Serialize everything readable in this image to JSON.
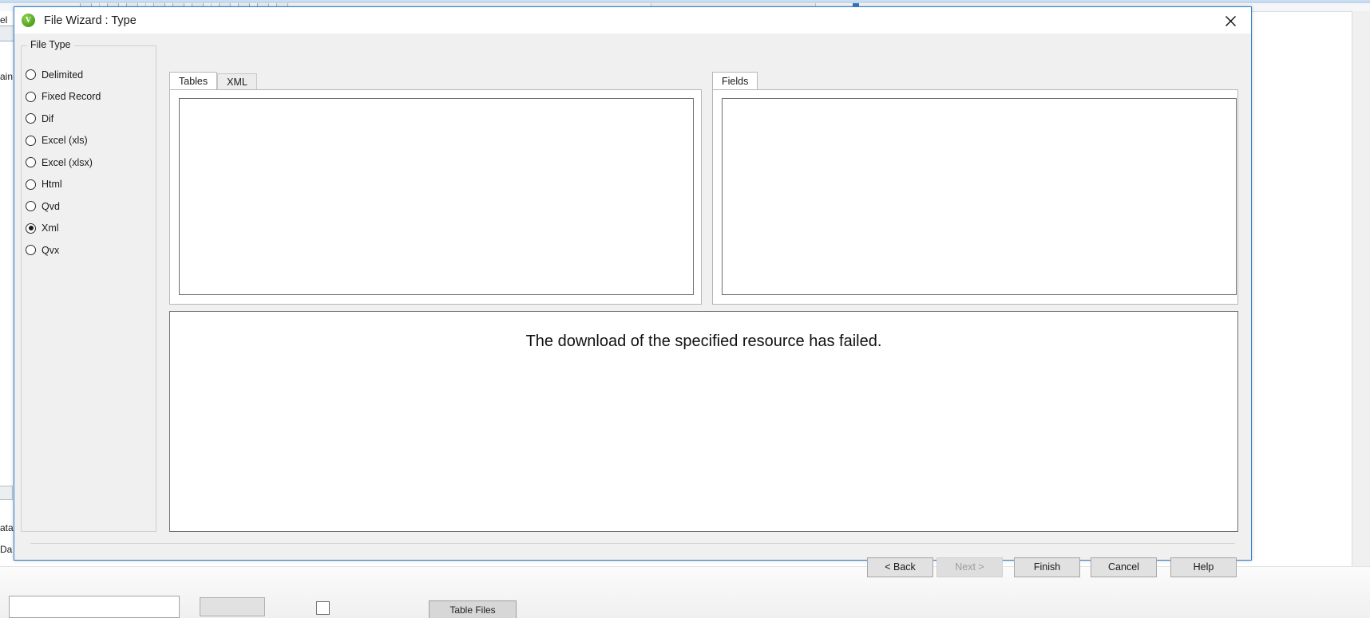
{
  "background": {
    "left_fragments": [
      "el",
      "ain",
      "ata",
      "Da"
    ],
    "table_files_button": "Table Files"
  },
  "dialog": {
    "title": "File Wizard : Type",
    "app_icon": "qlikview-logo-icon",
    "close_icon": "close-icon",
    "file_type": {
      "legend": "File Type",
      "selected": "Xml",
      "options": [
        "Delimited",
        "Fixed Record",
        "Dif",
        "Excel (xls)",
        "Excel (xlsx)",
        "Html",
        "Qvd",
        "Xml",
        "Qvx"
      ]
    },
    "tables_panel": {
      "tabs": [
        "Tables",
        "XML"
      ],
      "active_tab": "Tables",
      "items": []
    },
    "fields_panel": {
      "tabs": [
        "Fields"
      ],
      "active_tab": "Fields",
      "items": []
    },
    "preview": {
      "message": "The download of the specified resource has failed."
    },
    "footer": {
      "back": "< Back",
      "next": "Next >",
      "next_disabled": true,
      "finish": "Finish",
      "cancel": "Cancel",
      "help": "Help"
    }
  }
}
